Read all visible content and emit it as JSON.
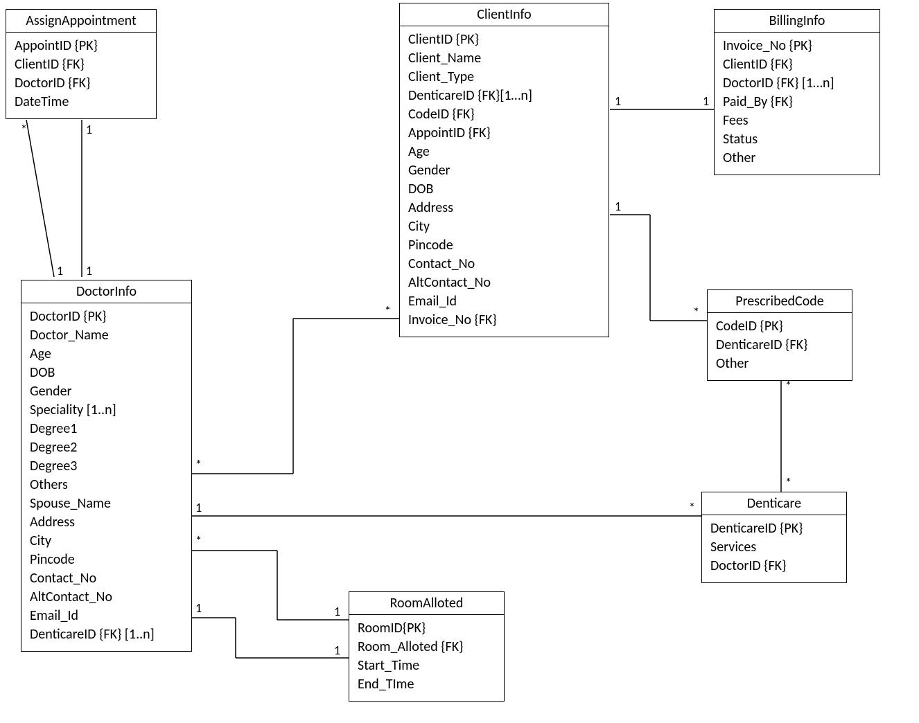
{
  "entities": {
    "assign_appointment": {
      "title": "AssignAppointment",
      "attrs": [
        "AppointID {PK}",
        "ClientID {FK}",
        "DoctorID {FK}",
        "DateTime"
      ]
    },
    "client_info": {
      "title": "ClientInfo",
      "attrs": [
        "ClientID {PK}",
        "Client_Name",
        "Client_Type",
        "DenticareID {FK}[1…n]",
        "CodeID {FK}",
        "AppointID {FK}",
        "Age",
        "Gender",
        "DOB",
        "Address",
        "City",
        "Pincode",
        "Contact_No",
        "AltContact_No",
        "Email_Id",
        "Invoice_No {FK}"
      ]
    },
    "billing_info": {
      "title": "BillingInfo",
      "attrs": [
        "Invoice_No {PK}",
        "ClientID {FK}",
        "DoctorID {FK} [1…n]",
        "Paid_By {FK}",
        "Fees",
        "Status",
        "Other"
      ]
    },
    "doctor_info": {
      "title": "DoctorInfo",
      "attrs": [
        "DoctorID {PK}",
        "Doctor_Name",
        "Age",
        "DOB",
        "Gender",
        "Speciality [1..n]",
        "Degree1",
        "Degree2",
        "Degree3",
        "Others",
        "Spouse_Name",
        "Address",
        "City",
        "Pincode",
        "Contact_No",
        "AltContact_No",
        "Email_Id",
        "DenticareID {FK} [1..n]"
      ]
    },
    "prescribed_code": {
      "title": "PrescribedCode",
      "attrs": [
        "CodeID {PK}",
        "DenticareID {FK}",
        "Other"
      ]
    },
    "denticare": {
      "title": "Denticare",
      "attrs": [
        "DenticareID {PK}",
        "Services",
        "DoctorID {FK}"
      ]
    },
    "room_alloted": {
      "title": "RoomAlloted",
      "attrs": [
        "RoomID{PK}",
        "Room_Alloted {FK}",
        "Start_Time",
        "End_TIme"
      ]
    }
  },
  "relationships": {
    "appoint_doctor_a": {
      "mult_top": "*",
      "mult_bottom": "1"
    },
    "appoint_doctor_b": {
      "mult_top": "1",
      "mult_bottom": "1"
    },
    "doctor_client": {
      "mult_left": "*",
      "mult_right": "*"
    },
    "doctor_denticare": {
      "mult_left": "1",
      "mult_right": "*"
    },
    "doctor_room_a": {
      "mult_left": "*",
      "mult_right": "1"
    },
    "doctor_room_b": {
      "mult_left": "1",
      "mult_right": "1"
    },
    "client_billing": {
      "mult_left": "1",
      "mult_right": "1"
    },
    "client_code": {
      "mult_left": "1",
      "mult_right": "*"
    },
    "code_denticare": {
      "mult_top": "*",
      "mult_bottom": "*"
    }
  }
}
